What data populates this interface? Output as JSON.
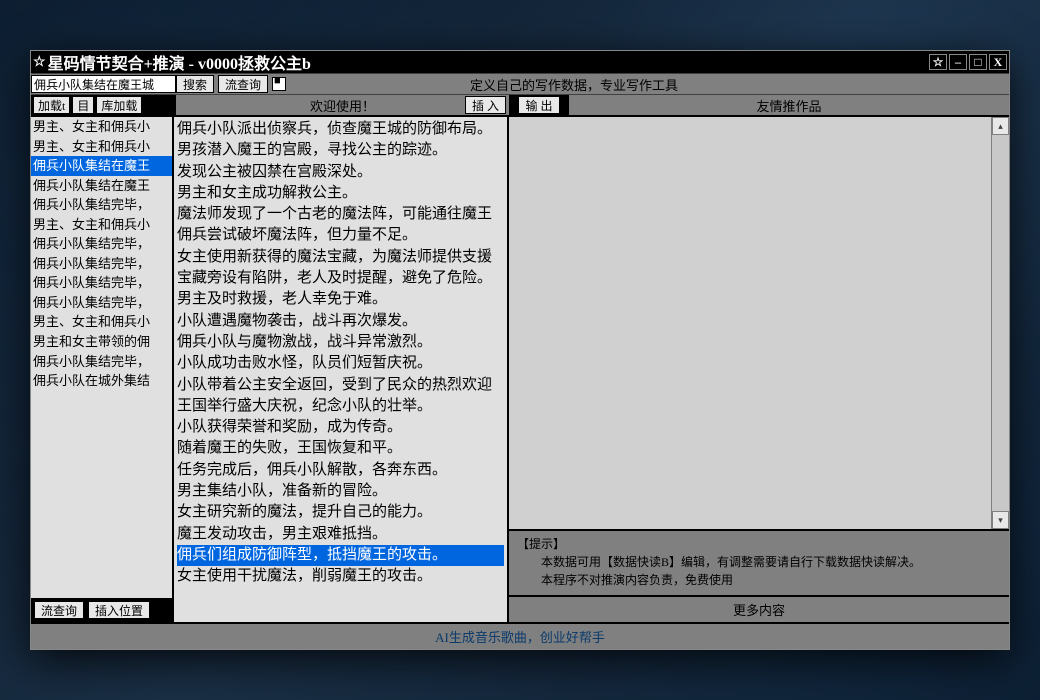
{
  "title": "星码情节契合+推演  -  v0000拯救公主b",
  "toolbar1": {
    "search_value": "佣兵小队集结在魔王城",
    "search_btn": "搜索",
    "flow_btn": "流查询",
    "tagline": "定义自己的写作数据，专业写作工具"
  },
  "toolbar2": {
    "load_btn": "加载t",
    "toc_btn": "目",
    "lib_btn": "库加载",
    "welcome": "欢迎使用！",
    "insert_btn": "插 入",
    "export_btn": "输 出",
    "recommend": "友情推作品"
  },
  "left_list": {
    "items": [
      "男主、女主和佣兵小",
      "男主、女主和佣兵小",
      "佣兵小队集结在魔王",
      "佣兵小队集结在魔王",
      "佣兵小队集结完毕，",
      "男主、女主和佣兵小",
      "佣兵小队集结完毕，",
      "佣兵小队集结完毕，",
      "佣兵小队集结完毕，",
      "佣兵小队集结完毕，",
      "男主、女主和佣兵小",
      "男主和女主带领的佣",
      "佣兵小队集结完毕，",
      "佣兵小队在城外集结"
    ],
    "selected_index": 2,
    "flow_query_btn": "流查询",
    "insert_pos_btn": "插入位置"
  },
  "story_lines": {
    "items": [
      "佣兵小队派出侦察兵，侦查魔王城的防御布局。",
      "男孩潜入魔王的宫殿，寻找公主的踪迹。",
      "发现公主被囚禁在宫殿深处。",
      "男主和女主成功解救公主。",
      "魔法师发现了一个古老的魔法阵，可能通往魔王",
      "佣兵尝试破坏魔法阵，但力量不足。",
      "女主使用新获得的魔法宝藏，为魔法师提供支援",
      "宝藏旁设有陷阱，老人及时提醒，避免了危险。",
      "男主及时救援，老人幸免于难。",
      "小队遭遇魔物袭击，战斗再次爆发。",
      "佣兵小队与魔物激战，战斗异常激烈。",
      "小队成功击败水怪，队员们短暂庆祝。",
      "小队带着公主安全返回，受到了民众的热烈欢迎",
      "王国举行盛大庆祝，纪念小队的壮举。",
      "小队获得荣誉和奖励，成为传奇。",
      "随着魔王的失败，王国恢复和平。",
      "任务完成后，佣兵小队解散，各奔东西。",
      "男主集结小队，准备新的冒险。",
      "女主研究新的魔法，提升自己的能力。",
      "魔王发动攻击，男主艰难抵挡。",
      "佣兵们组成防御阵型，抵挡魔王的攻击。",
      "女主使用干扰魔法，削弱魔王的攻击。"
    ],
    "selected_index": 20
  },
  "tips": {
    "header": "【提示】",
    "line1": "本数据可用【数据快读B】编辑，有调整需要请自行下载数据快读解决。",
    "line2": "本程序不对推演内容负责，免费使用"
  },
  "more_btn": "更多内容",
  "footer": "AI生成音乐歌曲，创业好帮手"
}
